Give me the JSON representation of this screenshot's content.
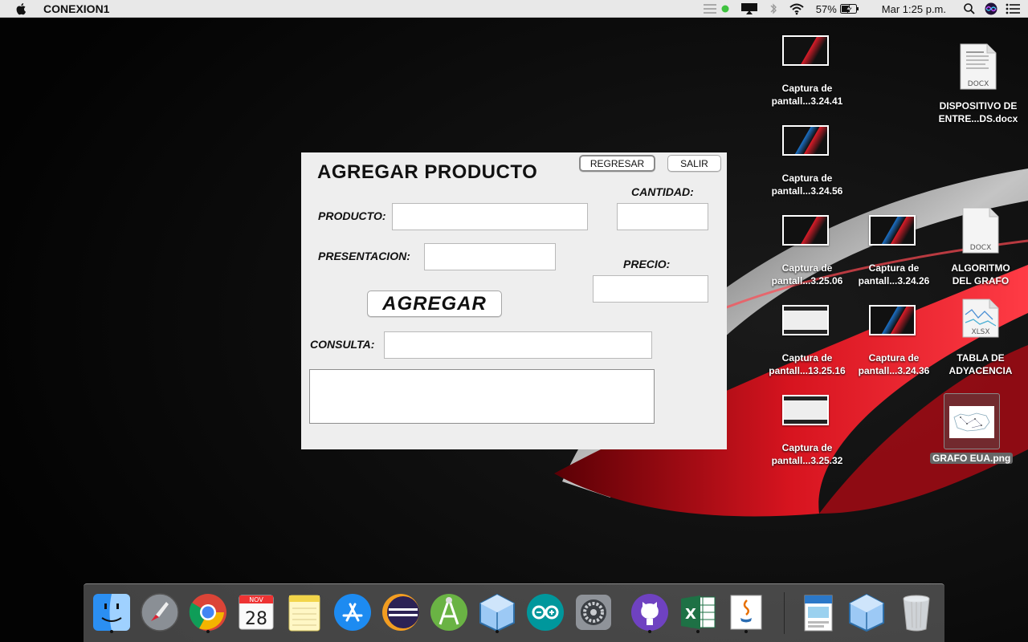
{
  "menubar": {
    "app_name": "CONEXION1",
    "battery": "57%",
    "clock": "Mar 1:25 p.m."
  },
  "window": {
    "title": "AGREGAR PRODUCTO",
    "buttons": {
      "regresar": "REGRESAR",
      "salir": "SALIR",
      "agregar": "AGREGAR"
    },
    "labels": {
      "cantidad": "CANTIDAD:",
      "producto": "PRODUCTO:",
      "presentacion": "PRESENTACION:",
      "precio": "PRECIO:",
      "consulta": "CONSULTA:"
    },
    "fields": {
      "producto": "",
      "cantidad": "",
      "presentacion": "",
      "precio": "",
      "consulta": "",
      "resultado": ""
    }
  },
  "desktop": {
    "items": [
      {
        "line1": "Captura de",
        "line2": "pantall...3.24.41",
        "thumb": "red"
      },
      {
        "line1": "Captura de",
        "line2": "pantall...3.24.56",
        "thumb": "blue"
      },
      {
        "line1": "Captura de",
        "line2": "pantall...3.25.06",
        "thumb": "red"
      },
      {
        "line1": "Captura de",
        "line2": "pantall...3.24.26",
        "thumb": "blue"
      },
      {
        "line1": "Captura de",
        "line2": "pantall...13.25.16",
        "thumb": "window"
      },
      {
        "line1": "Captura de",
        "line2": "pantall...3.24.36",
        "thumb": "blue"
      },
      {
        "line1": "Captura de",
        "line2": "pantall...3.25.32",
        "thumb": "window"
      }
    ],
    "docs": [
      {
        "line1": "DISPOSITIVO DE",
        "line2": "ENTRE...DS.docx",
        "tag": "DOCX"
      },
      {
        "line1": "ALGORITMO",
        "line2": "DEL GRAFO",
        "tag": "DOCX"
      },
      {
        "line1": "TABLA DE",
        "line2": "ADYACENCIA",
        "tag": "XLSX"
      }
    ],
    "selected": {
      "label": "GRAFO EUA.png"
    }
  },
  "dock": {
    "calendar_month": "NOV",
    "calendar_day": "28",
    "apps": [
      "finder-icon",
      "launchpad-icon",
      "chrome-icon",
      "calendar-icon",
      "notes-icon",
      "app-store-icon",
      "eclipse-icon",
      "android-studio-icon",
      "virtualbox-icon",
      "arduino-icon",
      "system-preferences-icon",
      "github-desktop-icon",
      "excel-icon",
      "java-icon",
      "preview-document-icon",
      "virtualbox-icon-2",
      "trash-icon"
    ]
  },
  "colors": {
    "accent_red": "#e8222d",
    "window_bg": "#eeeeee",
    "menubar_bg": "#e8e8e8"
  }
}
